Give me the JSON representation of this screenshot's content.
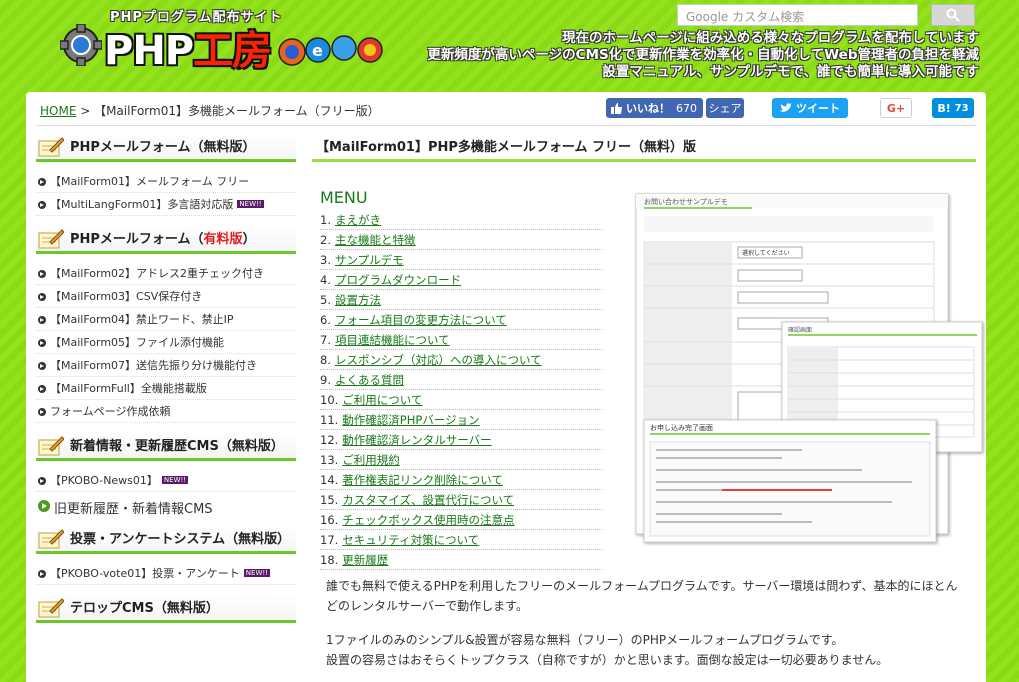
{
  "header": {
    "logo_sub": "PHPプログラム配布サイト",
    "logo_main_a": "PHP",
    "logo_main_b": "工房",
    "search_placeholder": "Google カスタム検索",
    "tagline": [
      "現在のホームページに組み込める様々なプログラムを配布しています",
      "更新頻度が高いページのCMS化で更新作業を効率化・自動化してWeb管理者の負担を軽減",
      "設置マニュアル、サンプルデモで、誰でも簡単に導入可能です"
    ]
  },
  "breadcrumb": {
    "home": "HOME",
    "sep": " > ",
    "current": "【MailForm01】多機能メールフォーム（フリー版）"
  },
  "social": {
    "fb_like": "いいね！",
    "fb_count": "670",
    "fb_share": "シェア",
    "tweet": "ツイート",
    "gplus": "G+",
    "hatena": "B!",
    "hatena_count": "73"
  },
  "sidebar": {
    "sections": [
      {
        "title": "PHPメールフォーム（無料版）",
        "items": [
          "【MailForm01】メールフォーム フリー",
          "【MultiLangForm01】多言語対応版"
        ]
      },
      {
        "title_a": "PHPメールフォーム（",
        "title_red": "有料版",
        "title_b": "）",
        "items": [
          "【MailForm02】アドレス2重チェック付き",
          "【MailForm03】CSV保存付き",
          "【MailForm04】禁止ワード、禁止IP",
          "【MailForm05】ファイル添付機能",
          "【MailForm07】送信先振り分け機能付き",
          "【MailFormFull】全機能搭載版",
          "フォームページ作成依頼"
        ]
      },
      {
        "title": "新着情報・更新履歴CMS（無料版）",
        "items": [
          "【PKOBO-News01】"
        ],
        "big": "旧更新履歴・新着情報CMS"
      },
      {
        "title": "投票・アンケートシステム（無料版）",
        "items": [
          "【PKOBO-vote01】投票・アンケート"
        ]
      },
      {
        "title": "テロップCMS（無料版）"
      }
    ],
    "new_badge": "NEW!!"
  },
  "content": {
    "title": "【MailForm01】PHP多機能メールフォーム フリー（無料）版",
    "menu_title": "MENU",
    "menu": [
      {
        "num": "1.",
        "label": "まえがき"
      },
      {
        "num": "2.",
        "label": "主な機能と特徴"
      },
      {
        "num": "3.",
        "label": "サンプルデモ"
      },
      {
        "num": "4.",
        "label": "プログラムダウンロード"
      },
      {
        "num": "5.",
        "label": "設置方法"
      },
      {
        "num": "6.",
        "label": "フォーム項目の変更方法について"
      },
      {
        "num": "7.",
        "label": "項目連結機能について"
      },
      {
        "num": "8.",
        "label": "レスポンシブ（対応）への導入について"
      },
      {
        "num": "9.",
        "label": "よくある質問"
      },
      {
        "num": "10.",
        "label": "ご利用について"
      },
      {
        "num": "11.",
        "label": "動作確認済PHPバージョン"
      },
      {
        "num": "12.",
        "label": "動作確認済レンタルサーバー"
      },
      {
        "num": "13.",
        "label": "ご利用規約"
      },
      {
        "num": "14.",
        "label": "著作権表記リンク削除について"
      },
      {
        "num": "15.",
        "label": "カスタマイズ、設置代行について"
      },
      {
        "num": "16.",
        "label": "チェックボックス使用時の注意点"
      },
      {
        "num": "17.",
        "label": "セキュリティ対策について"
      },
      {
        "num": "18.",
        "label": "更新履歴"
      }
    ],
    "shot": {
      "form_title": "お問い合わせサンプルデモ",
      "confirm_title": "確認画面",
      "complete_title": "お申し込み完了画面",
      "select_text": "選択してください"
    },
    "para1": "誰でも無料で使えるPHPを利用したフリーのメールフォームプログラムです。サーバー環境は問わず、基本的にほとんどのレンタルサーバーで動作します。",
    "para2a": "1ファイルのみのシンプル&設置が容易な無料（フリー）のPHPメールフォームプログラムです。",
    "para2b": "設置の容易さはおそらくトップクラス（自称ですが）かと思います。面倒な設定は一切必要ありません。"
  },
  "colors": {
    "background_green": "#8fe01a",
    "accent_green": "#6cc72b",
    "link_green": "#1a7a1a",
    "facebook": "#4267b2",
    "twitter": "#1da1f2",
    "hatena": "#008fde"
  }
}
